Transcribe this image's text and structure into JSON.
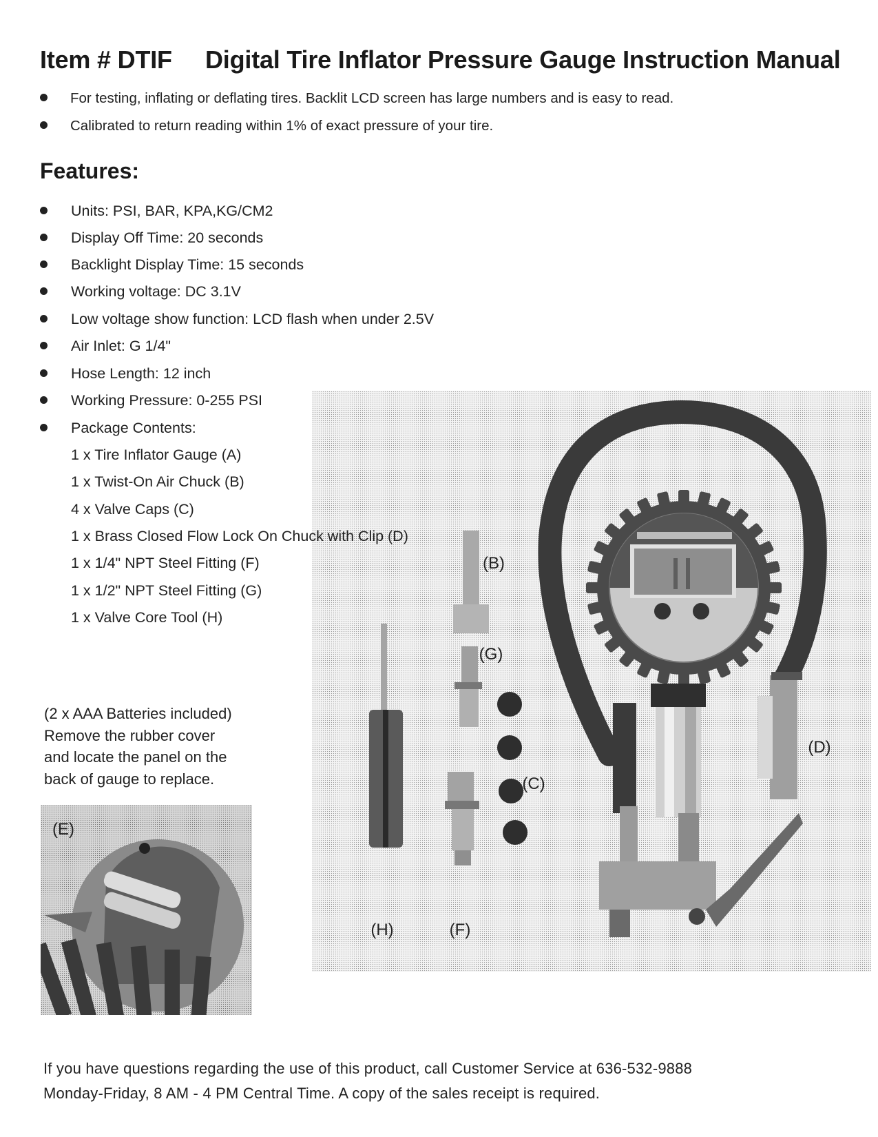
{
  "header": {
    "item_number": "Item # DTIF",
    "title": "Digital Tire Inflator Pressure Gauge Instruction Manual"
  },
  "intro_bullets": [
    "For testing, inflating or deflating tires. Backlit LCD screen has large numbers and is easy to read.",
    "Calibrated to return reading within 1% of exact pressure of your tire."
  ],
  "features": {
    "heading": "Features:",
    "items": [
      "Units: PSI, BAR, KPA,KG/CM2",
      "Display Off Time: 20 seconds",
      "Backlight Display Time: 15 seconds",
      "Working voltage: DC 3.1V",
      "Low voltage show function: LCD flash when under 2.5V",
      "Air Inlet: G 1/4\"",
      "Hose Length: 12 inch",
      "Working Pressure: 0-255 PSI",
      "Package Contents:"
    ],
    "package_contents": [
      "1 x Tire Inflator Gauge (A)",
      "1 x Twist-On Air Chuck (B)",
      "4 x Valve Caps (C)",
      "1 x Brass Closed Flow Lock On Chuck with Clip (D)",
      "1 x 1/4\" NPT Steel Fitting (F)",
      "1 x 1/2\" NPT Steel Fitting (G)",
      "1 x Valve Core Tool (H)"
    ]
  },
  "battery_note": [
    "(2 x AAA Batteries included)",
    "Remove the rubber cover",
    "and locate the panel on the",
    "back of gauge to replace."
  ],
  "product_photo": {
    "labels": {
      "b": "(B)",
      "g": "(G)",
      "c": "(C)",
      "d": "(D)",
      "h": "(H)",
      "f": "(F)"
    }
  },
  "battery_photo": {
    "label": "(E)"
  },
  "footer": [
    "If you have questions regarding the use of this product, call Customer Service at 636-532-9888",
    "Monday-Friday, 8 AM - 4 PM Central Time. A copy of the sales receipt is required."
  ]
}
